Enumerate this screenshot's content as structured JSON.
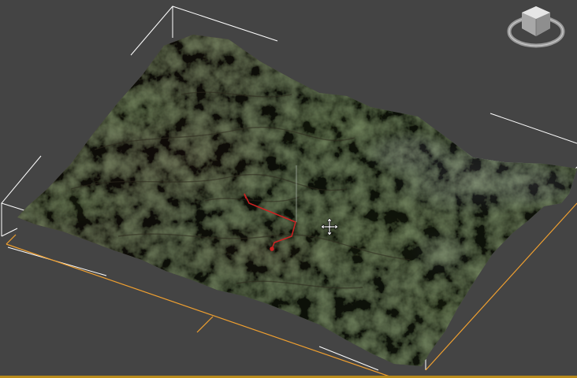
{
  "viewport": {
    "background_color": "#444444",
    "bounding_box_color": "#ffffff",
    "selection_edge_color": "#f0a030",
    "gizmo_color": "#cc2222",
    "bottom_strip_color": "#b88a1a"
  },
  "viewcube": {
    "icon": "viewcube-icon"
  },
  "cursor": {
    "icon": "move-crosshair-icon"
  },
  "terrain": {
    "icon": "terrain-mesh"
  }
}
